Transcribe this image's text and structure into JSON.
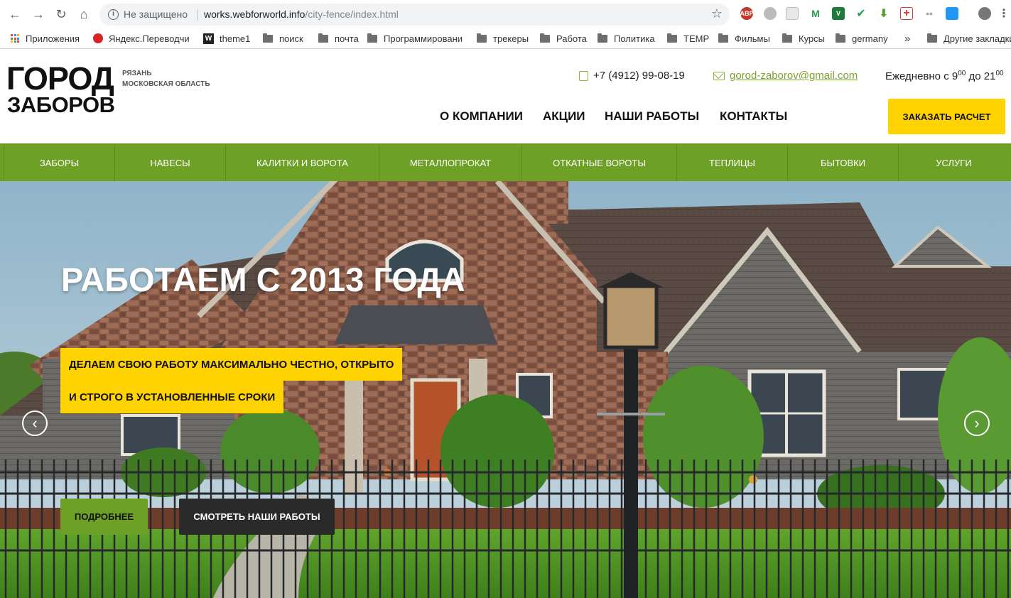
{
  "browser": {
    "security_label": "Не защищено",
    "url_host": "works.webforworld.info",
    "url_path": "/city-fence/index.html",
    "extensions": [
      "ABP",
      "",
      "",
      "M",
      "V",
      "",
      "",
      "",
      "",
      ""
    ]
  },
  "bookmarks": [
    {
      "label": "Приложения",
      "icon": "apps-icon"
    },
    {
      "label": "Яндекс.Переводчи",
      "icon": "translate-icon"
    },
    {
      "label": "theme1",
      "icon": "w-icon"
    },
    {
      "label": "поиск",
      "icon": "folder-icon"
    },
    {
      "label": "почта",
      "icon": "folder-icon"
    },
    {
      "label": "Программировани",
      "icon": "folder-icon"
    },
    {
      "label": "трекеры",
      "icon": "folder-icon"
    },
    {
      "label": "Работа",
      "icon": "folder-icon"
    },
    {
      "label": "Политика",
      "icon": "folder-icon"
    },
    {
      "label": "TEMP",
      "icon": "folder-icon"
    },
    {
      "label": "Фильмы",
      "icon": "folder-icon"
    },
    {
      "label": "Курсы",
      "icon": "folder-icon"
    },
    {
      "label": "germany",
      "icon": "folder-icon"
    }
  ],
  "bookmarks_more": "»",
  "bookmarks_other": "Другие закладки",
  "header": {
    "logo_line1": "ГОРОД",
    "logo_line2": "ЗАБОРОВ",
    "region_line1": "РЯЗАНЬ",
    "region_line2": "МОСКОВСКАЯ ОБЛАСТЬ",
    "phone": "+7 (4912) 99-08-19",
    "email": "gorod-zaborov@gmail.com",
    "hours_prefix": "Ежедневно с 9",
    "hours_sup1": "00",
    "hours_mid": " до 21",
    "hours_sup2": "00",
    "nav": [
      "О КОМПАНИИ",
      "АКЦИИ",
      "НАШИ РАБОТЫ",
      "КОНТАКТЫ"
    ],
    "order_button": "ЗАКАЗАТЬ РАСЧЕТ"
  },
  "categories": [
    "ЗАБОРЫ",
    "НАВЕСЫ",
    "КАЛИТКИ И ВОРОТА",
    "МЕТАЛЛОПРОКАТ",
    "ОТКАТНЫЕ ВОРОТЫ",
    "ТЕПЛИЦЫ",
    "БЫТОВКИ",
    "УСЛУГИ"
  ],
  "hero": {
    "title": "РАБОТАЕМ С 2013 ГОДА",
    "tag_line1": "ДЕЛАЕМ СВОЮ РАБОТУ МАКСИМАЛЬНО ЧЕСТНО, ОТКРЫТО",
    "tag_line2": "И СТРОГО В УСТАНОВЛЕННЫЕ СРОКИ",
    "btn_more": "ПОДРОБНЕЕ",
    "btn_works": "СМОТРЕТЬ НАШИ РАБОТЫ",
    "prev_arrow": "‹",
    "next_arrow": "›"
  },
  "colors": {
    "accent_green": "#6ea026",
    "accent_yellow": "#ffd300",
    "link_green": "#7aa52a"
  }
}
